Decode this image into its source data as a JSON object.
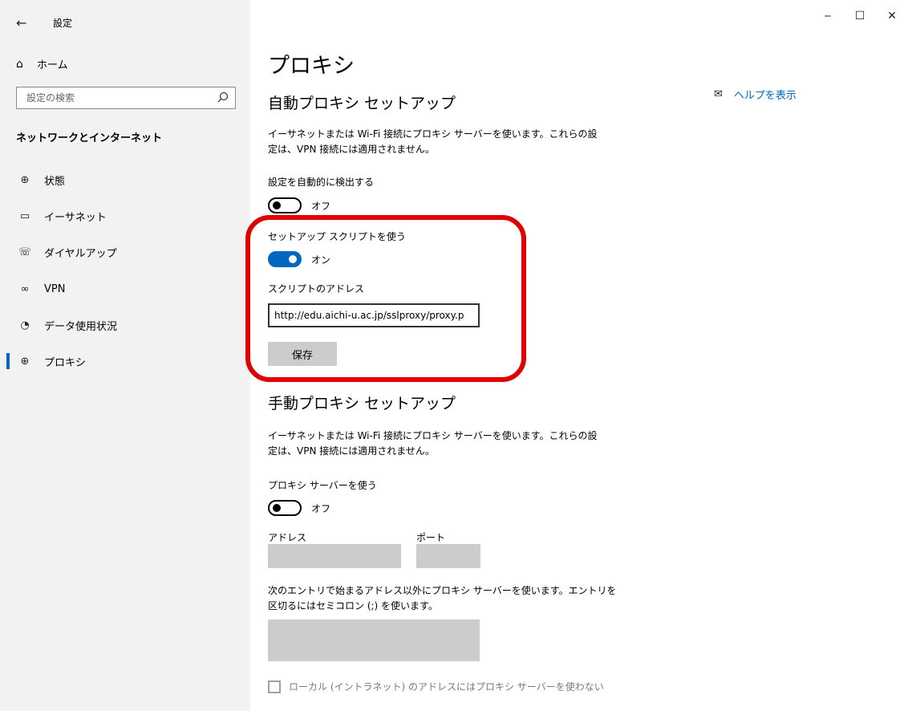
{
  "app": {
    "back_icon": "arrow-left-icon",
    "title": "設定"
  },
  "window_controls": {
    "minimize": "‒",
    "maximize": "☐",
    "close": "✕"
  },
  "sidebar": {
    "home_label": "ホーム",
    "search_placeholder": "設定の検索",
    "section_header": "ネットワークとインターネット",
    "items": [
      {
        "label": "状態",
        "icon": "globe-status-icon",
        "selected": false
      },
      {
        "label": "イーサネット",
        "icon": "monitor-ethernet-icon",
        "selected": false
      },
      {
        "label": "ダイヤルアップ",
        "icon": "dialup-icon",
        "selected": false
      },
      {
        "label": "VPN",
        "icon": "vpn-icon",
        "selected": false
      },
      {
        "label": "データ使用状況",
        "icon": "pie-chart-icon",
        "selected": false
      },
      {
        "label": "プロキシ",
        "icon": "globe-icon",
        "selected": true
      }
    ],
    "accent_color": "#0067c0"
  },
  "main": {
    "title": "プロキシ",
    "help_link": "ヘルプを表示",
    "auto": {
      "heading": "自動プロキシ セットアップ",
      "description": "イーサネットまたは Wi-Fi 接続にプロキシ サーバーを使います。これらの設定は、VPN 接続には適用されません。",
      "detect_label": "設定を自動的に検出する",
      "detect_state": "オフ",
      "script_label": "セットアップ スクリプトを使う",
      "script_state": "オン",
      "address_label": "スクリプトのアドレス",
      "address_value": "http://edu.aichi-u.ac.jp/sslproxy/proxy.p",
      "save_label": "保存"
    },
    "manual": {
      "heading": "手動プロキシ セットアップ",
      "description": "イーサネットまたは Wi-Fi 接続にプロキシ サーバーを使います。これらの設定は、VPN 接続には適用されません。",
      "use_label": "プロキシ サーバーを使う",
      "use_state": "オフ",
      "address_label": "アドレス",
      "port_label": "ポート",
      "exceptions_description": "次のエントリで始まるアドレス以外にプロキシ サーバーを使います。エントリを区切るにはセミコロン (;) を使います。",
      "local_checkbox_label": "ローカル (イントラネット) のアドレスにはプロキシ サーバーを使わない"
    },
    "highlight_color": "#e00000"
  }
}
